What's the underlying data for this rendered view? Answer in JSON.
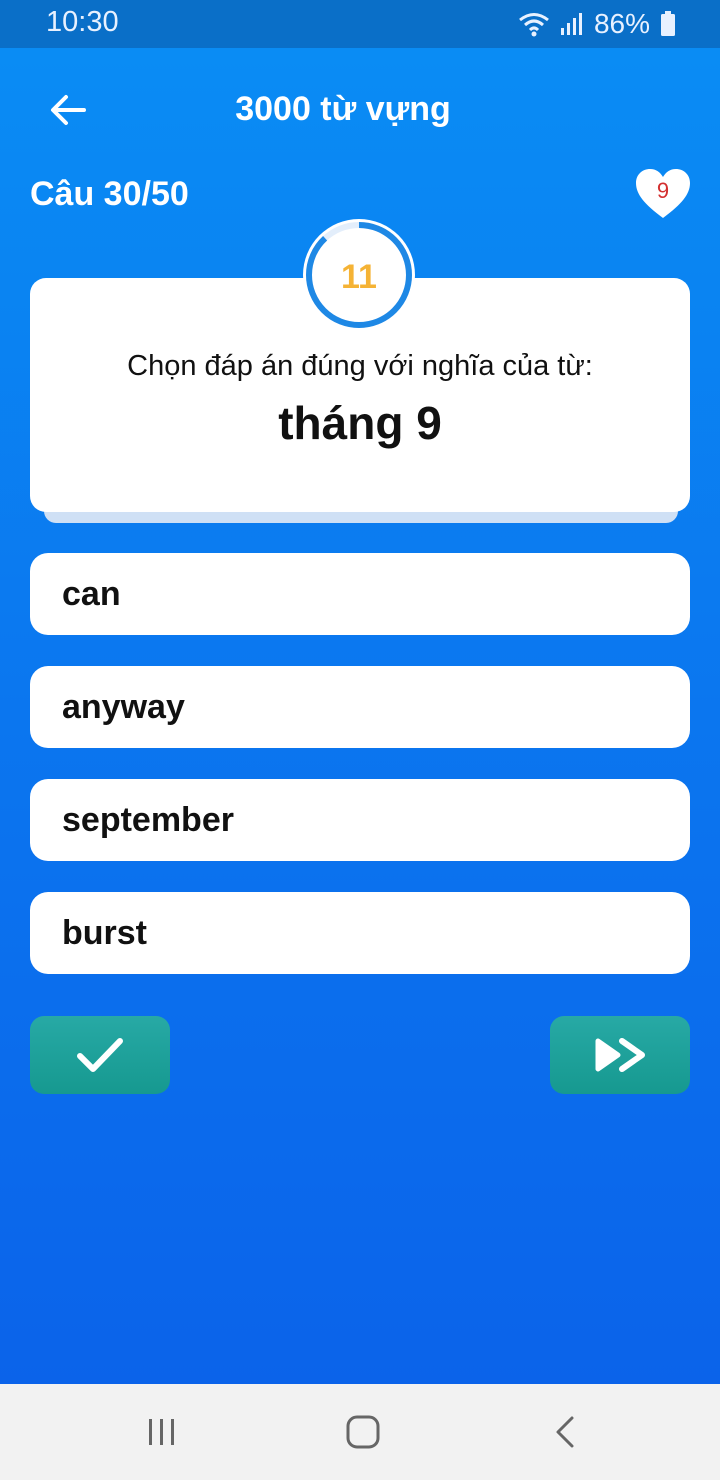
{
  "status_bar": {
    "time": "10:30",
    "battery": "86%",
    "icons": [
      "wifi-icon",
      "signal-icon",
      "battery-icon"
    ]
  },
  "header": {
    "title": "3000 từ vựng",
    "back_icon": "arrow-left-icon"
  },
  "quiz": {
    "counter": "Câu 30/50",
    "lives": "9",
    "timer": "11",
    "timer_progress": 0.88,
    "prompt": "Chọn đáp án đúng với nghĩa của từ:",
    "word": "tháng 9",
    "options": [
      {
        "label": "can"
      },
      {
        "label": "anyway"
      },
      {
        "label": "september"
      },
      {
        "label": "burst"
      }
    ]
  },
  "actions": {
    "check_icon": "checkmark-icon",
    "skip_icon": "fast-forward-icon"
  },
  "nav": {
    "icons": [
      "recent-apps-icon",
      "home-icon",
      "back-nav-icon"
    ]
  },
  "colors": {
    "header_bg": "#0a8cf4",
    "accent_teal": "#1fa19b",
    "timer_text": "#f5b335",
    "heart_text": "#d32f2f"
  }
}
